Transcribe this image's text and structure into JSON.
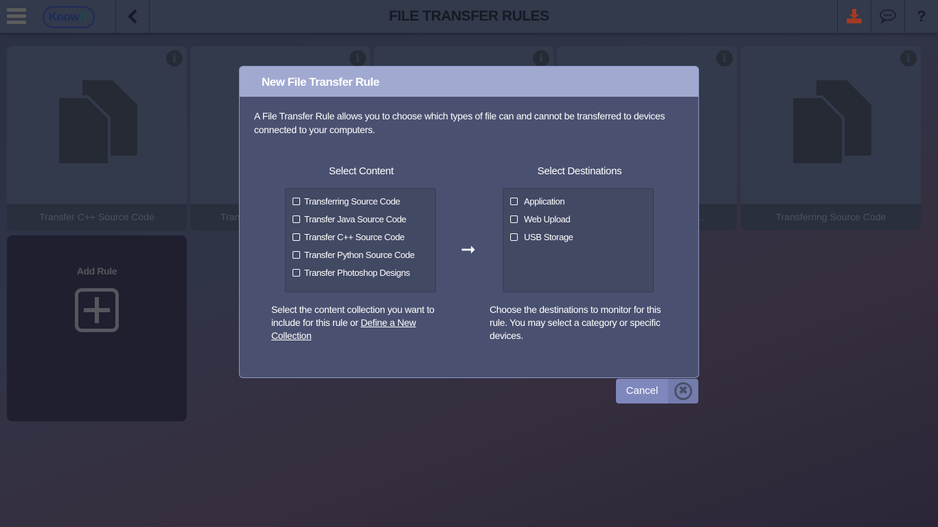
{
  "header": {
    "title": "FILE TRANSFER RULES",
    "logo": {
      "text": "Know",
      "accent": "IT"
    },
    "download_color": "#a33a22"
  },
  "cards": [
    {
      "label": "Transfer C++ Source Code"
    },
    {
      "label": "Tran"
    },
    {
      "label": ""
    },
    {
      "label": "..."
    },
    {
      "label": "Transferring Source Code"
    }
  ],
  "add_rule": {
    "label": "Add Rule"
  },
  "modal": {
    "title": "New File Transfer Rule",
    "intro": "A File Transfer Rule allows you to choose which types of file can and cannot be transferred to devices connected to your computers.",
    "content": {
      "heading": "Select Content",
      "items": [
        "Transferring Source Code",
        "Transfer Java Source Code",
        "Transfer C++ Source Code",
        "Transfer Python Source Code",
        "Transfer Photoshop Designs"
      ],
      "desc": "Select the content collection you want to include for this rule or ",
      "link": "Define a New Collection"
    },
    "destinations": {
      "heading": "Select Destinations",
      "items": [
        "Application",
        "Web Upload",
        "USB Storage"
      ],
      "desc": "Choose the destinations to monitor for this rule. You may select a category or specific devices."
    },
    "arrow": "➞"
  },
  "cancel": {
    "label": "Cancel"
  }
}
